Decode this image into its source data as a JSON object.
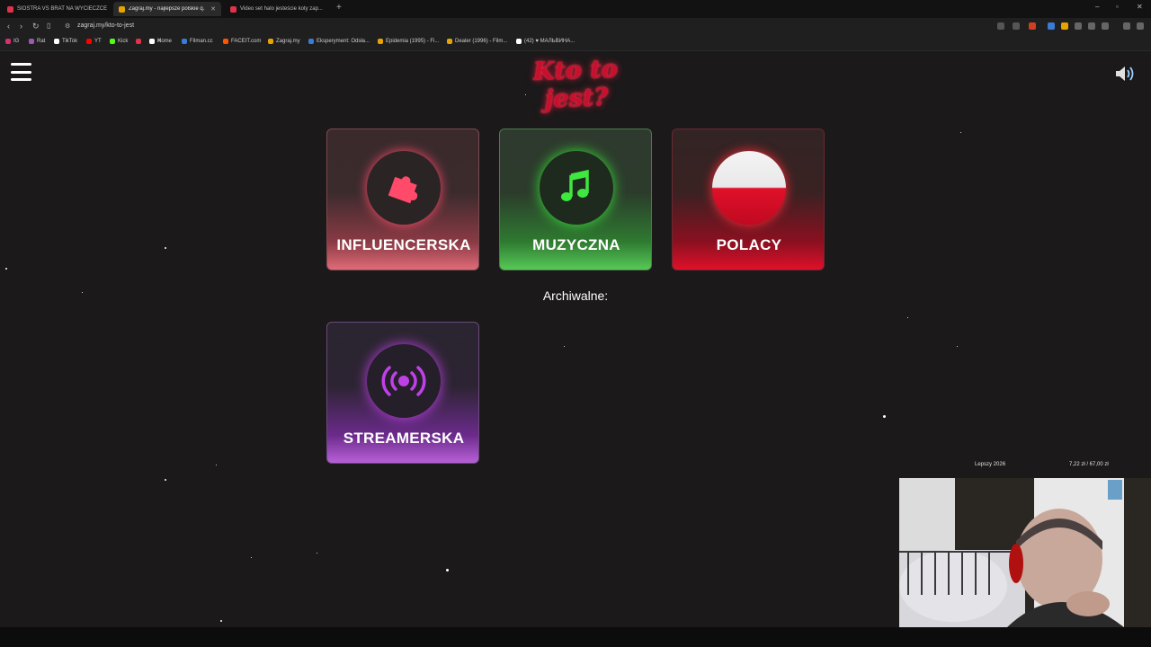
{
  "browser": {
    "tabs": [
      {
        "label": "SIOSTRA VS BRAT NA WYCIECZCE",
        "color": "#e0334a",
        "active": false
      },
      {
        "label": "Zagraj.my - najlepsze polskie q...",
        "color": "#e6a400",
        "active": true
      },
      {
        "label": "Video set halo jesteście koty zap...",
        "color": "#e0334a",
        "active": false
      }
    ],
    "new_tab": "+",
    "url": "zagraj.my/kto-to-jest",
    "bookmarks": [
      {
        "label": "IG",
        "color": "#d6306f"
      },
      {
        "label": "Rat",
        "color": "#9b59b6"
      },
      {
        "label": "TikTok",
        "color": "#ffffff"
      },
      {
        "label": "YT",
        "color": "#ff0000"
      },
      {
        "label": "Kick",
        "color": "#53fc18"
      },
      {
        "label": "",
        "color": "#e0334a"
      },
      {
        "label": "Home",
        "color": "#e0334a"
      },
      {
        "label": "X",
        "color": "#ffffff"
      },
      {
        "label": "Filman.cc",
        "color": "#3a7bd5"
      },
      {
        "label": "FACEIT.com",
        "color": "#ff5500"
      },
      {
        "label": "Zagraj.my",
        "color": "#e6a400"
      },
      {
        "label": "Eksperyment: Odsła...",
        "color": "#3a7bd5"
      },
      {
        "label": "Epidemia (1995) - Fi...",
        "color": "#e6a400"
      },
      {
        "label": "Dealer (1996) - Film...",
        "color": "#e6a400"
      },
      {
        "label": "(42) ♥ МАЛЬВИНА...",
        "color": "#ffffff"
      }
    ]
  },
  "page": {
    "logo_text": "Kto to jest?",
    "categories": [
      {
        "label": "INFLUENCERSKA",
        "icon": "puzzle-icon"
      },
      {
        "label": "MUZYCZNA",
        "icon": "music-note-icon"
      },
      {
        "label": "POLACY",
        "icon": "polish-flag-icon"
      }
    ],
    "archive_heading": "Archiwalne:",
    "archive_categories": [
      {
        "label": "STREAMERSKA",
        "icon": "broadcast-icon"
      }
    ]
  },
  "overlay": {
    "goal_label": "Lepszy 2026",
    "goal_value": "7,22 zł / 67,00 zł"
  },
  "colors": {
    "influ": "#e0334a",
    "muz": "#2ecc40",
    "pol": "#e0102a",
    "stream": "#c040e8"
  }
}
